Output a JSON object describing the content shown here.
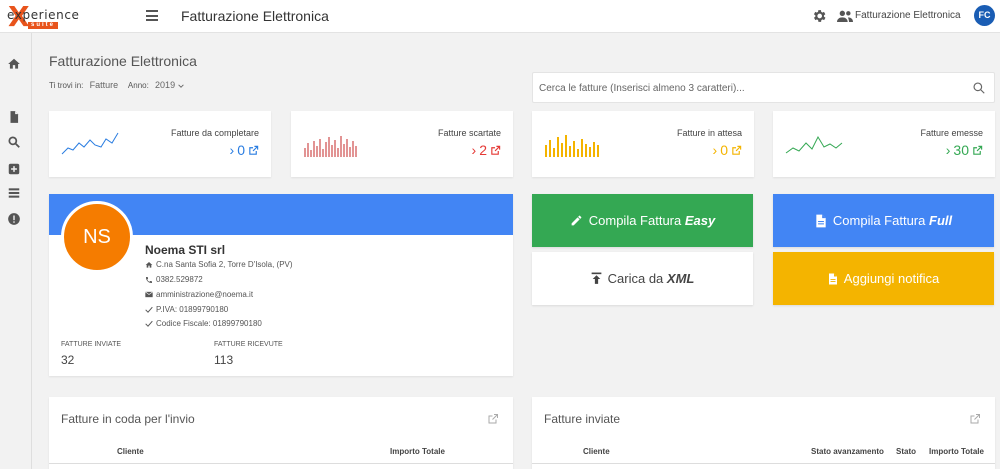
{
  "topbar": {
    "logo_word": "experience",
    "logo_suite": "suite",
    "app_title": "Fatturazione Elettronica",
    "users_label": "Fatturazione Elettronica",
    "avatar_initials": "FC"
  },
  "page": {
    "title": "Fatturazione Elettronica",
    "breadcrumb_label": "Ti trovi in:",
    "breadcrumb_value": "Fatture",
    "year_label": "Anno:",
    "year_value": "2019"
  },
  "search": {
    "placeholder": "Cerca le fatture (Inserisci almeno 3 caratteri)..."
  },
  "stats": [
    {
      "label": "Fatture da completare",
      "count": "0",
      "color": "#2a7de1"
    },
    {
      "label": "Fatture scartate",
      "count": "2",
      "color": "#e53935"
    },
    {
      "label": "Fatture in attesa",
      "count": "0",
      "color": "#f4b400"
    },
    {
      "label": "Fatture emesse",
      "count": "30",
      "color": "#34a853"
    }
  ],
  "company": {
    "initials": "NS",
    "name": "Noema STI srl",
    "address": "C.na Santa Sofia 2, Torre D'Isola, (PV)",
    "phone": "0382.529872",
    "email": "amministrazione@noema.it",
    "piva": "P.IVA: 01899790180",
    "codice_fiscale": "Codice Fiscale: 01899790180",
    "sent_label": "FATTURE INVIATE",
    "sent_value": "32",
    "received_label": "FATTURE RICEVUTE",
    "received_value": "113"
  },
  "actions": {
    "easy_prefix": "Compila Fattura",
    "easy_bold": "Easy",
    "full_prefix": "Compila Fattura",
    "full_bold": "Full",
    "xml_prefix": "Carica da",
    "xml_bold": "XML",
    "notify_label": "Aggiungi notifica"
  },
  "panels": {
    "queue": {
      "title": "Fatture in coda per l'invio",
      "col_client": "Cliente",
      "col_total": "Importo Totale"
    },
    "sent": {
      "title": "Fatture inviate",
      "col_client": "Cliente",
      "col_progress": "Stato avanzamento",
      "col_state": "Stato",
      "col_total": "Importo Totale"
    }
  },
  "colors": {
    "banner": "#4285f4",
    "easy": "#34a853",
    "full": "#4285f4",
    "notify": "#f4b400",
    "avatar": "#f57c00",
    "brand": "#e8541c"
  },
  "icons": [
    "menu-icon",
    "gear-icon",
    "users-icon",
    "home-icon",
    "file-icon",
    "search-icon",
    "plus-square-icon",
    "list-icon",
    "info-icon",
    "external-link-icon",
    "pencil-icon",
    "upload-icon",
    "document-icon"
  ]
}
